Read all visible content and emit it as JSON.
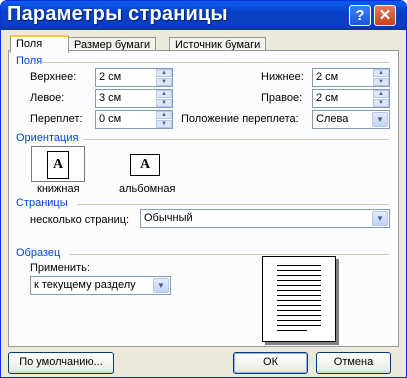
{
  "window": {
    "title": "Параметры страницы"
  },
  "title_buttons": {
    "help": "?",
    "close": "✕"
  },
  "tabs": [
    "Поля",
    "Размер бумаги",
    "Источник бумаги"
  ],
  "margins": {
    "section": "Поля",
    "top": {
      "label": "Верхнее:",
      "value": "2 см"
    },
    "left": {
      "label": "Левое:",
      "value": "3 см"
    },
    "gutter": {
      "label": "Переплет:",
      "value": "0 см"
    },
    "bottom": {
      "label": "Нижнее:",
      "value": "2 см"
    },
    "right": {
      "label": "Правое:",
      "value": "2 см"
    },
    "gutter_position": {
      "label": "Положение переплета:",
      "value": "Слева"
    }
  },
  "orientation": {
    "section": "Ориентация",
    "portrait": "книжная",
    "landscape": "альбомная",
    "icon_letter": "A",
    "selected": "portrait"
  },
  "pages": {
    "section": "Страницы",
    "multiple_label": "несколько страниц:",
    "multiple_value": "Обычный"
  },
  "sample": {
    "section": "Образец",
    "apply_label": "Применить:",
    "apply_value": "к текущему разделу"
  },
  "buttons": {
    "default": "По умолчанию...",
    "ok": "ОК",
    "cancel": "Отмена"
  }
}
